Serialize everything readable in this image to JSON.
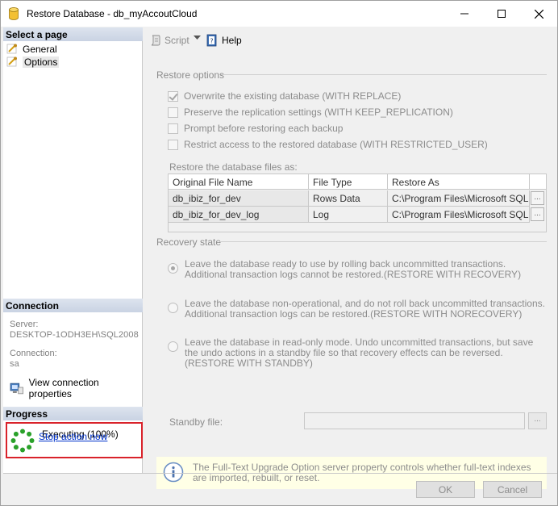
{
  "window": {
    "title": "Restore Database - db_myAccoutCloud"
  },
  "left": {
    "select_page_heading": "Select a page",
    "pages": [
      {
        "label": "General"
      },
      {
        "label": "Options"
      }
    ],
    "connection_heading": "Connection",
    "server_label": "Server:",
    "server_value": "DESKTOP-1ODH3EH\\SQL2008",
    "connection_label": "Connection:",
    "connection_value": "sa",
    "view_connection_properties": "View connection properties",
    "progress_heading": "Progress",
    "progress_status": "Executing (100%)",
    "stop_action": "Stop action now"
  },
  "toolbar": {
    "script_label": "Script",
    "help_label": "Help"
  },
  "restore_options": {
    "title": "Restore options",
    "checkboxes": [
      {
        "label": "Overwrite the existing database (WITH REPLACE)",
        "checked": true
      },
      {
        "label": "Preserve the replication settings (WITH KEEP_REPLICATION)",
        "checked": false
      },
      {
        "label": "Prompt before restoring each backup",
        "checked": false
      },
      {
        "label": "Restrict access to the restored database (WITH RESTRICTED_USER)",
        "checked": false
      }
    ],
    "files_label": "Restore the database files as:",
    "columns": [
      "Original File Name",
      "File Type",
      "Restore As"
    ],
    "rows": [
      {
        "original": "db_ibiz_for_dev",
        "type": "Rows Data",
        "restore_as": "C:\\Program Files\\Microsoft SQL..."
      },
      {
        "original": "db_ibiz_for_dev_log",
        "type": "Log",
        "restore_as": "C:\\Program Files\\Microsoft SQL..."
      }
    ],
    "browse_label": "..."
  },
  "recovery": {
    "title": "Recovery state",
    "options": [
      {
        "text": "Leave the database ready to use by rolling back uncommitted transactions. Additional transaction logs cannot be restored.(RESTORE WITH RECOVERY)",
        "selected": true
      },
      {
        "text": "Leave the database non-operational, and do not roll back uncommitted transactions. Additional transaction logs can be restored.(RESTORE WITH NORECOVERY)",
        "selected": false
      },
      {
        "text": "Leave the database in read-only mode. Undo uncommitted transactions, but save the undo actions in a standby file so that recovery effects can be reversed.(RESTORE WITH STANDBY)",
        "selected": false
      }
    ],
    "standby_label": "Standby file:",
    "standby_value": "",
    "standby_browse": "..."
  },
  "info": {
    "text": "The Full-Text Upgrade Option server property controls whether full-text indexes are imported, rebuilt, or reset."
  },
  "buttons": {
    "ok": "OK",
    "cancel": "Cancel"
  },
  "colors": {
    "progress_highlight": "#d9222a",
    "link": "#0033cc",
    "spinner": "#2aa12a"
  }
}
